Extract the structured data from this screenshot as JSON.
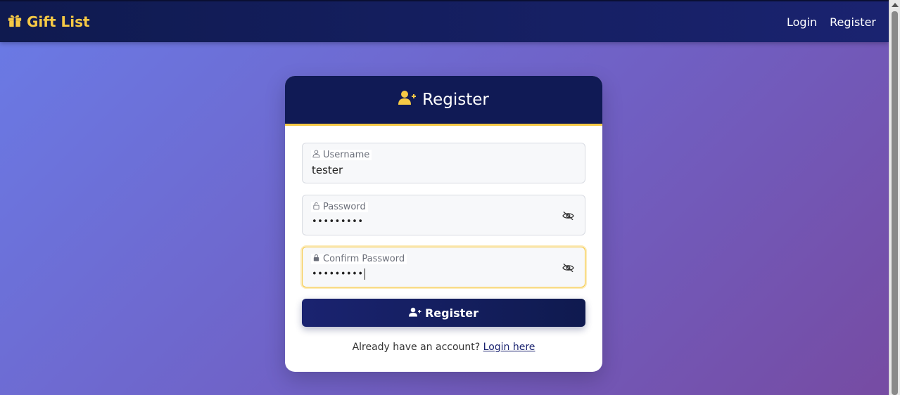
{
  "navbar": {
    "brand": "Gift List",
    "links": {
      "login": "Login",
      "register": "Register"
    }
  },
  "card": {
    "title": "Register",
    "fields": {
      "username": {
        "label": "Username",
        "value": "tester"
      },
      "password": {
        "label": "Password",
        "value": "•••••••••"
      },
      "confirm": {
        "label": "Confirm Password",
        "value": "•••••••••"
      }
    },
    "submit_label": "Register",
    "footer": {
      "prompt": "Already have an account? ",
      "link": "Login here"
    }
  },
  "icons": {
    "brand": "gift-icon",
    "title": "user-plus-icon",
    "username": "user-icon",
    "password": "lock-open-icon",
    "confirm": "lock-icon",
    "toggle": "eye-slash-icon"
  },
  "colors": {
    "accent": "#f6c945",
    "navy": "#101a55",
    "background_start": "#6a7be6",
    "background_end": "#764ba2"
  }
}
